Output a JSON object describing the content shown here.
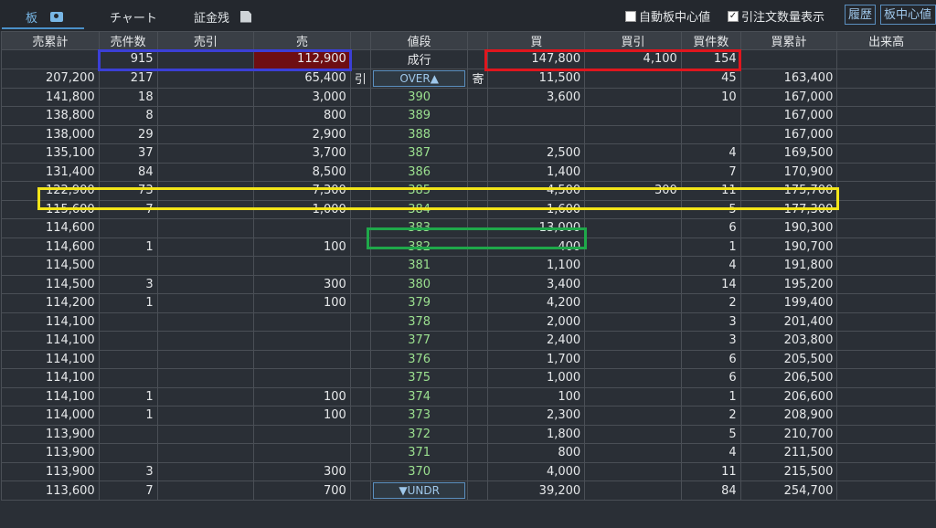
{
  "tabs": [
    {
      "label": "板",
      "icon": "camera-icon"
    },
    {
      "label": "チャート"
    },
    {
      "label": "証金残",
      "icon": "export-icon"
    }
  ],
  "options": {
    "auto_center": "自動板中心値",
    "show_order_qty": "引注文数量表示",
    "auto_center_checked": false,
    "show_order_qty_checked": true
  },
  "buttons": {
    "history": "履歴",
    "center": "板中心値"
  },
  "headers": [
    "売累計",
    "売件数",
    "売引",
    "売",
    "",
    "値段",
    "",
    "買",
    "買引",
    "買件数",
    "買累計",
    "出来高"
  ],
  "market_row": {
    "sell_count": "915",
    "sell": "112,900",
    "price": "成行",
    "buy": "147,800",
    "buy_hiki": "4,100",
    "buy_count": "154"
  },
  "over_row": {
    "sell_cum": "207,200",
    "sell_count": "217",
    "sell": "65,400",
    "mark_left": "引",
    "label": "OVER▲",
    "mark_right": "寄",
    "buy": "11,500",
    "buy_count": "45",
    "buy_cum": "163,400"
  },
  "rows": [
    {
      "sell_cum": "141,800",
      "sell_count": "18",
      "sell": "3,000",
      "price": "390",
      "buy": "3,600",
      "buy_hiki": "",
      "buy_count": "10",
      "buy_cum": "167,000"
    },
    {
      "sell_cum": "138,800",
      "sell_count": "8",
      "sell": "800",
      "price": "389",
      "buy": "",
      "buy_hiki": "",
      "buy_count": "",
      "buy_cum": "167,000"
    },
    {
      "sell_cum": "138,000",
      "sell_count": "29",
      "sell": "2,900",
      "price": "388",
      "buy": "",
      "buy_hiki": "",
      "buy_count": "",
      "buy_cum": "167,000"
    },
    {
      "sell_cum": "135,100",
      "sell_count": "37",
      "sell": "3,700",
      "price": "387",
      "buy": "2,500",
      "buy_hiki": "",
      "buy_count": "4",
      "buy_cum": "169,500"
    },
    {
      "sell_cum": "131,400",
      "sell_count": "84",
      "sell": "8,500",
      "price": "386",
      "buy": "1,400",
      "buy_hiki": "",
      "buy_count": "7",
      "buy_cum": "170,900"
    },
    {
      "sell_cum": "122,900",
      "sell_count": "73",
      "sell": "7,300",
      "price": "385",
      "buy": "4,500",
      "buy_hiki": "300",
      "buy_count": "11",
      "buy_cum": "175,700"
    },
    {
      "sell_cum": "115,600",
      "sell_count": "7",
      "sell": "1,000",
      "price": "384",
      "buy": "1,600",
      "buy_hiki": "",
      "buy_count": "5",
      "buy_cum": "177,300"
    },
    {
      "sell_cum": "114,600",
      "sell_count": "",
      "sell": "",
      "price": "383",
      "buy": "13,000",
      "buy_hiki": "",
      "buy_count": "6",
      "buy_cum": "190,300"
    },
    {
      "sell_cum": "114,600",
      "sell_count": "1",
      "sell": "100",
      "price": "382",
      "buy": "400",
      "buy_hiki": "",
      "buy_count": "1",
      "buy_cum": "190,700"
    },
    {
      "sell_cum": "114,500",
      "sell_count": "",
      "sell": "",
      "price": "381",
      "buy": "1,100",
      "buy_hiki": "",
      "buy_count": "4",
      "buy_cum": "191,800"
    },
    {
      "sell_cum": "114,500",
      "sell_count": "3",
      "sell": "300",
      "price": "380",
      "buy": "3,400",
      "buy_hiki": "",
      "buy_count": "14",
      "buy_cum": "195,200"
    },
    {
      "sell_cum": "114,200",
      "sell_count": "1",
      "sell": "100",
      "price": "379",
      "buy": "4,200",
      "buy_hiki": "",
      "buy_count": "2",
      "buy_cum": "199,400"
    },
    {
      "sell_cum": "114,100",
      "sell_count": "",
      "sell": "",
      "price": "378",
      "buy": "2,000",
      "buy_hiki": "",
      "buy_count": "3",
      "buy_cum": "201,400"
    },
    {
      "sell_cum": "114,100",
      "sell_count": "",
      "sell": "",
      "price": "377",
      "buy": "2,400",
      "buy_hiki": "",
      "buy_count": "3",
      "buy_cum": "203,800"
    },
    {
      "sell_cum": "114,100",
      "sell_count": "",
      "sell": "",
      "price": "376",
      "buy": "1,700",
      "buy_hiki": "",
      "buy_count": "6",
      "buy_cum": "205,500"
    },
    {
      "sell_cum": "114,100",
      "sell_count": "",
      "sell": "",
      "price": "375",
      "buy": "1,000",
      "buy_hiki": "",
      "buy_count": "6",
      "buy_cum": "206,500"
    },
    {
      "sell_cum": "114,100",
      "sell_count": "1",
      "sell": "100",
      "price": "374",
      "buy": "100",
      "buy_hiki": "",
      "buy_count": "1",
      "buy_cum": "206,600"
    },
    {
      "sell_cum": "114,000",
      "sell_count": "1",
      "sell": "100",
      "price": "373",
      "buy": "2,300",
      "buy_hiki": "",
      "buy_count": "2",
      "buy_cum": "208,900"
    },
    {
      "sell_cum": "113,900",
      "sell_count": "",
      "sell": "",
      "price": "372",
      "buy": "1,800",
      "buy_hiki": "",
      "buy_count": "5",
      "buy_cum": "210,700"
    },
    {
      "sell_cum": "113,900",
      "sell_count": "",
      "sell": "",
      "price": "371",
      "buy": "800",
      "buy_hiki": "",
      "buy_count": "4",
      "buy_cum": "211,500"
    },
    {
      "sell_cum": "113,900",
      "sell_count": "3",
      "sell": "300",
      "price": "370",
      "buy": "4,000",
      "buy_hiki": "",
      "buy_count": "11",
      "buy_cum": "215,500"
    }
  ],
  "under_row": {
    "sell_cum": "113,600",
    "sell_count": "7",
    "sell": "700",
    "label": "▼UNDR",
    "buy": "39,200",
    "buy_count": "84",
    "buy_cum": "254,700"
  },
  "colors": {
    "highlight_blue": "#3b3fd6",
    "highlight_red": "#e0161e",
    "highlight_yellow": "#f2e51a",
    "highlight_green": "#1fa84a",
    "price_green": "#9be08f",
    "sell_market_bg": "#6e0e12"
  }
}
